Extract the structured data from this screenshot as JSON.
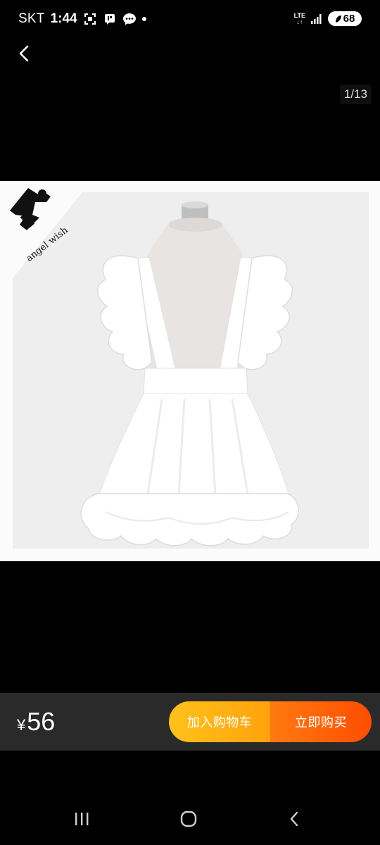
{
  "status_bar": {
    "carrier": "SKT",
    "time": "1:44",
    "network": "LTE",
    "battery": "68",
    "icons": [
      "screenshot-icon",
      "notification-icon",
      "chat-icon",
      "dot-icon",
      "signal-icon"
    ]
  },
  "gallery": {
    "page_indicator": "1/13",
    "image_watermark": "angel wish",
    "image_description_icon": "sewing-machine-logo"
  },
  "action_bar": {
    "currency": "¥",
    "price": "56",
    "add_to_cart_label": "加入购物车",
    "buy_now_label": "立即购买",
    "colors": {
      "cart_gradient": [
        "#ffc21b",
        "#ffa20c"
      ],
      "buy_gradient": [
        "#ff7a10",
        "#ff4d00"
      ],
      "bar_background": "#2a2a2a"
    }
  },
  "nav_bar": {
    "icons": [
      "recent-apps-icon",
      "home-icon",
      "back-icon"
    ]
  }
}
